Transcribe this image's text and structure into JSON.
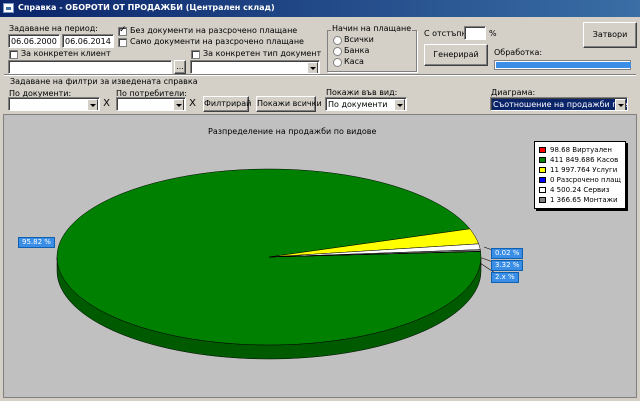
{
  "window": {
    "title": "Справка - ОБОРОТИ ОТ ПРОДАЖБИ (Централен склад)"
  },
  "period": {
    "label": "Задаване на период:",
    "from": "06.06.2000",
    "to": "06.06.2014"
  },
  "checks": {
    "no_installments": "Без документи на разсрочено плащане",
    "only_installments": "Само документи на разсрочено плащане",
    "specific_client": "За конкретен клиент",
    "specific_doc_type": "За конкретен тип документ"
  },
  "client_lookup": {
    "button": "..."
  },
  "payment": {
    "title": "Начин на плащане",
    "options": [
      "Всички",
      "Банка",
      "Каса"
    ]
  },
  "discount": {
    "label": "С отстъпка:",
    "value": "",
    "unit": "%"
  },
  "buttons": {
    "generate": "Генерирай",
    "close": "Затвори",
    "filter": "Филтрирай",
    "show_all": "Покажи всички"
  },
  "processing": {
    "label": "Обработка:",
    "progress": 1.0
  },
  "filters": {
    "title": "Задаване на филтри за изведената справка",
    "by_documents": "По документи:",
    "by_users": "По потребители:",
    "show_by": "Покажи във вид:",
    "show_by_value": "По документи",
    "diagram": "Диаграма:",
    "diagram_value": "Съотношение на продажби през WEB",
    "clear": "X"
  },
  "chart_data": {
    "type": "pie",
    "title": "Разпределение на продажби по видове",
    "legend_position": "top-right",
    "series": [
      {
        "name": "98.68 Виртуален",
        "value": 98.68,
        "color": "#ff0000"
      },
      {
        "name": "411 849.686 Касов",
        "value": 411849.686,
        "color": "#008000"
      },
      {
        "name": "11 997.764 Услуги",
        "value": 11997.764,
        "color": "#ffff00"
      },
      {
        "name": "0 Разсрочено плащ",
        "value": 0,
        "color": "#0000ff"
      },
      {
        "name": "4 500.24 Сервиз",
        "value": 4500.24,
        "color": "#ffffff"
      },
      {
        "name": "1 366.65 Монтажи",
        "value": 1366.65,
        "color": "#808080"
      }
    ],
    "labels": [
      "95.82 %",
      "0.02 %",
      "3.32 %",
      "2.x %"
    ]
  }
}
